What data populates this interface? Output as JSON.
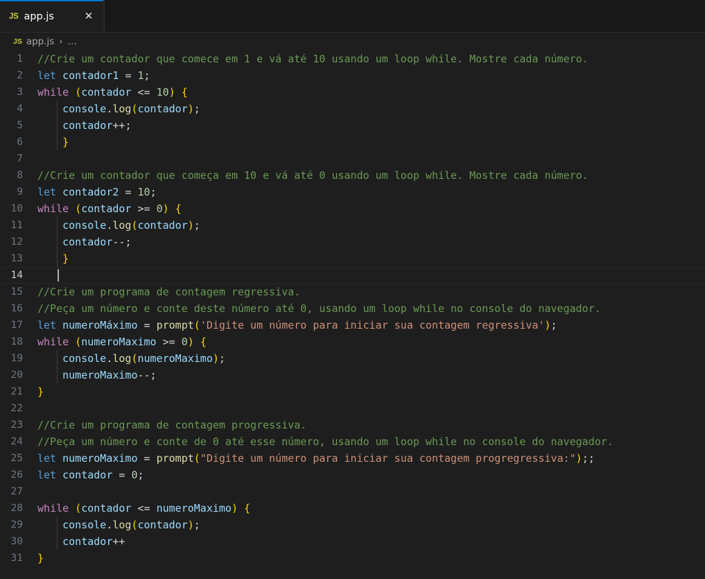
{
  "window": {
    "background": "#1e1e1e",
    "accent": "#0078d4"
  },
  "tabbar": {
    "tabs": [
      {
        "filetype_badge": "JS",
        "label": "app.js",
        "close_label": "✕",
        "active": true
      }
    ]
  },
  "breadcrumb": {
    "filetype_badge": "JS",
    "file": "app.js",
    "separator": "›",
    "ellipsis": "…"
  },
  "editor": {
    "language": "javascript",
    "active_line": 14,
    "total_lines": 31,
    "line_numbers": [
      "1",
      "2",
      "3",
      "4",
      "5",
      "6",
      "7",
      "8",
      "9",
      "10",
      "11",
      "12",
      "13",
      "14",
      "15",
      "16",
      "17",
      "18",
      "19",
      "20",
      "21",
      "22",
      "23",
      "24",
      "25",
      "26",
      "27",
      "28",
      "29",
      "30",
      "31"
    ],
    "lines": [
      "//Crie um contador que comece em 1 e vá até 10 usando um loop while. Mostre cada número.",
      "let contador1 = 1;",
      "while (contador <= 10) {",
      "    console.log(contador);",
      "    contador++;",
      "    }",
      "",
      "//Crie um contador que começa em 10 e vá até 0 usando um loop while. Mostre cada número.",
      "let contador2 = 10;",
      "while (contador >= 0) {",
      "    console.log(contador);",
      "    contador--;",
      "    }",
      "",
      "//Crie um programa de contagem regressiva.",
      "//Peça um número e conte deste número até 0, usando um loop while no console do navegador.",
      "let numeroMáximo = prompt('Digite um número para iniciar sua contagem regressiva');",
      "while (numeroMaximo >= 0) {",
      "    console.log(numeroMaximo);",
      "    numeroMaximo--;",
      "}",
      "",
      "//Crie um programa de contagem progressiva.",
      "//Peça um número e conte de 0 até esse número, usando um loop while no console do navegador.",
      "let numeroMaximo = prompt(\"Digite um número para iniciar sua contagem progregressiva:\");;",
      "let contador = 0;",
      "",
      "while (contador <= numeroMaximo) {",
      "    console.log(contador);",
      "    contador++",
      "}"
    ],
    "theme_colors": {
      "comment": "#6a9955",
      "keyword": "#569cd6",
      "control": "#c586c0",
      "variable": "#9cdcfe",
      "function": "#dcdcaa",
      "number": "#b5cea8",
      "string": "#ce9178",
      "bracket_level_0": "#ffd700",
      "bracket_level_1": "#da70d6",
      "foreground": "#d4d4d4",
      "line_number": "#6e7681",
      "line_number_active": "#cccccc"
    }
  }
}
